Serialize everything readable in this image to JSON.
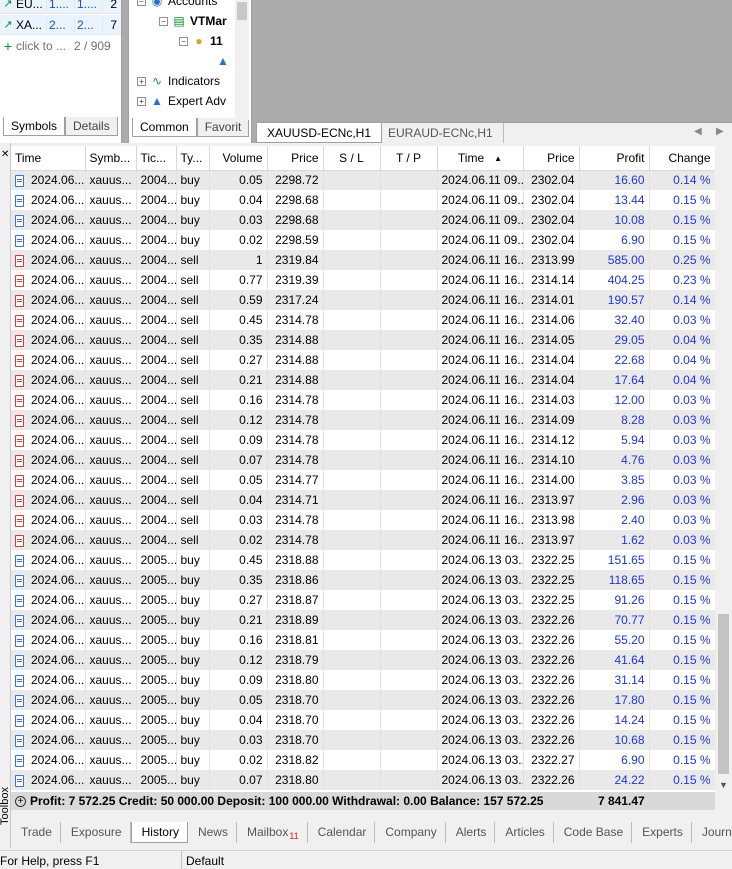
{
  "market_watch": {
    "rows": [
      {
        "symbol": "EU...",
        "bid": "1....",
        "ask": "1....",
        "spread": "2"
      },
      {
        "symbol": "XA...",
        "bid": "2...",
        "ask": "2...",
        "spread": "7"
      }
    ],
    "add_label": "click to ...",
    "count": "2 / 909",
    "tabs": [
      "Symbols",
      "Details"
    ]
  },
  "navigator": {
    "accounts": "Accounts",
    "server": "VTMar",
    "account": "11",
    "indicators": "Indicators",
    "expert_advisors": "Expert Adv",
    "tabs": [
      "Common",
      "Favorit"
    ]
  },
  "chart_tabs": [
    "XAUUSD-ECNc,H1",
    "EURAUD-ECNc,H1"
  ],
  "columns": [
    "Time",
    "Symb...",
    "Tic...",
    "Ty...",
    "Volume",
    "Price",
    "S / L",
    "T / P",
    "Time",
    "Price",
    "Profit",
    "Change"
  ],
  "rows": [
    {
      "time": "2024.06...",
      "symbol": "xauus...",
      "ticket": "2004...",
      "type": "buy",
      "volume": "0.05",
      "price": "2298.72",
      "sl": "",
      "tp": "",
      "close_time": "2024.06.11 09...",
      "close_price": "2302.04",
      "profit": "16.60",
      "change": "0.14 %"
    },
    {
      "time": "2024.06...",
      "symbol": "xauus...",
      "ticket": "2004...",
      "type": "buy",
      "volume": "0.04",
      "price": "2298.68",
      "sl": "",
      "tp": "",
      "close_time": "2024.06.11 09...",
      "close_price": "2302.04",
      "profit": "13.44",
      "change": "0.15 %"
    },
    {
      "time": "2024.06...",
      "symbol": "xauus...",
      "ticket": "2004...",
      "type": "buy",
      "volume": "0.03",
      "price": "2298.68",
      "sl": "",
      "tp": "",
      "close_time": "2024.06.11 09...",
      "close_price": "2302.04",
      "profit": "10.08",
      "change": "0.15 %"
    },
    {
      "time": "2024.06...",
      "symbol": "xauus...",
      "ticket": "2004...",
      "type": "buy",
      "volume": "0.02",
      "price": "2298.59",
      "sl": "",
      "tp": "",
      "close_time": "2024.06.11 09...",
      "close_price": "2302.04",
      "profit": "6.90",
      "change": "0.15 %"
    },
    {
      "time": "2024.06...",
      "symbol": "xauus...",
      "ticket": "2004...",
      "type": "sell",
      "volume": "1",
      "price": "2319.84",
      "sl": "",
      "tp": "",
      "close_time": "2024.06.11 16...",
      "close_price": "2313.99",
      "profit": "585.00",
      "change": "0.25 %"
    },
    {
      "time": "2024.06...",
      "symbol": "xauus...",
      "ticket": "2004...",
      "type": "sell",
      "volume": "0.77",
      "price": "2319.39",
      "sl": "",
      "tp": "",
      "close_time": "2024.06.11 16...",
      "close_price": "2314.14",
      "profit": "404.25",
      "change": "0.23 %"
    },
    {
      "time": "2024.06...",
      "symbol": "xauus...",
      "ticket": "2004...",
      "type": "sell",
      "volume": "0.59",
      "price": "2317.24",
      "sl": "",
      "tp": "",
      "close_time": "2024.06.11 16...",
      "close_price": "2314.01",
      "profit": "190.57",
      "change": "0.14 %"
    },
    {
      "time": "2024.06...",
      "symbol": "xauus...",
      "ticket": "2004...",
      "type": "sell",
      "volume": "0.45",
      "price": "2314.78",
      "sl": "",
      "tp": "",
      "close_time": "2024.06.11 16...",
      "close_price": "2314.06",
      "profit": "32.40",
      "change": "0.03 %"
    },
    {
      "time": "2024.06...",
      "symbol": "xauus...",
      "ticket": "2004...",
      "type": "sell",
      "volume": "0.35",
      "price": "2314.88",
      "sl": "",
      "tp": "",
      "close_time": "2024.06.11 16...",
      "close_price": "2314.05",
      "profit": "29.05",
      "change": "0.04 %"
    },
    {
      "time": "2024.06...",
      "symbol": "xauus...",
      "ticket": "2004...",
      "type": "sell",
      "volume": "0.27",
      "price": "2314.88",
      "sl": "",
      "tp": "",
      "close_time": "2024.06.11 16...",
      "close_price": "2314.04",
      "profit": "22.68",
      "change": "0.04 %"
    },
    {
      "time": "2024.06...",
      "symbol": "xauus...",
      "ticket": "2004...",
      "type": "sell",
      "volume": "0.21",
      "price": "2314.88",
      "sl": "",
      "tp": "",
      "close_time": "2024.06.11 16...",
      "close_price": "2314.04",
      "profit": "17.64",
      "change": "0.04 %"
    },
    {
      "time": "2024.06...",
      "symbol": "xauus...",
      "ticket": "2004...",
      "type": "sell",
      "volume": "0.16",
      "price": "2314.78",
      "sl": "",
      "tp": "",
      "close_time": "2024.06.11 16...",
      "close_price": "2314.03",
      "profit": "12.00",
      "change": "0.03 %"
    },
    {
      "time": "2024.06...",
      "symbol": "xauus...",
      "ticket": "2004...",
      "type": "sell",
      "volume": "0.12",
      "price": "2314.78",
      "sl": "",
      "tp": "",
      "close_time": "2024.06.11 16...",
      "close_price": "2314.09",
      "profit": "8.28",
      "change": "0.03 %"
    },
    {
      "time": "2024.06...",
      "symbol": "xauus...",
      "ticket": "2004...",
      "type": "sell",
      "volume": "0.09",
      "price": "2314.78",
      "sl": "",
      "tp": "",
      "close_time": "2024.06.11 16...",
      "close_price": "2314.12",
      "profit": "5.94",
      "change": "0.03 %"
    },
    {
      "time": "2024.06...",
      "symbol": "xauus...",
      "ticket": "2004...",
      "type": "sell",
      "volume": "0.07",
      "price": "2314.78",
      "sl": "",
      "tp": "",
      "close_time": "2024.06.11 16...",
      "close_price": "2314.10",
      "profit": "4.76",
      "change": "0.03 %"
    },
    {
      "time": "2024.06...",
      "symbol": "xauus...",
      "ticket": "2004...",
      "type": "sell",
      "volume": "0.05",
      "price": "2314.77",
      "sl": "",
      "tp": "",
      "close_time": "2024.06.11 16...",
      "close_price": "2314.00",
      "profit": "3.85",
      "change": "0.03 %"
    },
    {
      "time": "2024.06...",
      "symbol": "xauus...",
      "ticket": "2004...",
      "type": "sell",
      "volume": "0.04",
      "price": "2314.71",
      "sl": "",
      "tp": "",
      "close_time": "2024.06.11 16...",
      "close_price": "2313.97",
      "profit": "2.96",
      "change": "0.03 %"
    },
    {
      "time": "2024.06...",
      "symbol": "xauus...",
      "ticket": "2004...",
      "type": "sell",
      "volume": "0.03",
      "price": "2314.78",
      "sl": "",
      "tp": "",
      "close_time": "2024.06.11 16...",
      "close_price": "2313.98",
      "profit": "2.40",
      "change": "0.03 %"
    },
    {
      "time": "2024.06...",
      "symbol": "xauus...",
      "ticket": "2004...",
      "type": "sell",
      "volume": "0.02",
      "price": "2314.78",
      "sl": "",
      "tp": "",
      "close_time": "2024.06.11 16...",
      "close_price": "2313.97",
      "profit": "1.62",
      "change": "0.03 %"
    },
    {
      "time": "2024.06...",
      "symbol": "xauus...",
      "ticket": "2005...",
      "type": "buy",
      "volume": "0.45",
      "price": "2318.88",
      "sl": "",
      "tp": "",
      "close_time": "2024.06.13 03...",
      "close_price": "2322.25",
      "profit": "151.65",
      "change": "0.15 %"
    },
    {
      "time": "2024.06...",
      "symbol": "xauus...",
      "ticket": "2005...",
      "type": "buy",
      "volume": "0.35",
      "price": "2318.86",
      "sl": "",
      "tp": "",
      "close_time": "2024.06.13 03...",
      "close_price": "2322.25",
      "profit": "118.65",
      "change": "0.15 %"
    },
    {
      "time": "2024.06...",
      "symbol": "xauus...",
      "ticket": "2005...",
      "type": "buy",
      "volume": "0.27",
      "price": "2318.87",
      "sl": "",
      "tp": "",
      "close_time": "2024.06.13 03...",
      "close_price": "2322.25",
      "profit": "91.26",
      "change": "0.15 %"
    },
    {
      "time": "2024.06...",
      "symbol": "xauus...",
      "ticket": "2005...",
      "type": "buy",
      "volume": "0.21",
      "price": "2318.89",
      "sl": "",
      "tp": "",
      "close_time": "2024.06.13 03...",
      "close_price": "2322.26",
      "profit": "70.77",
      "change": "0.15 %"
    },
    {
      "time": "2024.06...",
      "symbol": "xauus...",
      "ticket": "2005...",
      "type": "buy",
      "volume": "0.16",
      "price": "2318.81",
      "sl": "",
      "tp": "",
      "close_time": "2024.06.13 03...",
      "close_price": "2322.26",
      "profit": "55.20",
      "change": "0.15 %"
    },
    {
      "time": "2024.06...",
      "symbol": "xauus...",
      "ticket": "2005...",
      "type": "buy",
      "volume": "0.12",
      "price": "2318.79",
      "sl": "",
      "tp": "",
      "close_time": "2024.06.13 03...",
      "close_price": "2322.26",
      "profit": "41.64",
      "change": "0.15 %"
    },
    {
      "time": "2024.06...",
      "symbol": "xauus...",
      "ticket": "2005...",
      "type": "buy",
      "volume": "0.09",
      "price": "2318.80",
      "sl": "",
      "tp": "",
      "close_time": "2024.06.13 03...",
      "close_price": "2322.26",
      "profit": "31.14",
      "change": "0.15 %"
    },
    {
      "time": "2024.06...",
      "symbol": "xauus...",
      "ticket": "2005...",
      "type": "buy",
      "volume": "0.05",
      "price": "2318.70",
      "sl": "",
      "tp": "",
      "close_time": "2024.06.13 03...",
      "close_price": "2322.26",
      "profit": "17.80",
      "change": "0.15 %"
    },
    {
      "time": "2024.06...",
      "symbol": "xauus...",
      "ticket": "2005...",
      "type": "buy",
      "volume": "0.04",
      "price": "2318.70",
      "sl": "",
      "tp": "",
      "close_time": "2024.06.13 03...",
      "close_price": "2322.26",
      "profit": "14.24",
      "change": "0.15 %"
    },
    {
      "time": "2024.06...",
      "symbol": "xauus...",
      "ticket": "2005...",
      "type": "buy",
      "volume": "0.03",
      "price": "2318.70",
      "sl": "",
      "tp": "",
      "close_time": "2024.06.13 03...",
      "close_price": "2322.26",
      "profit": "10.68",
      "change": "0.15 %"
    },
    {
      "time": "2024.06...",
      "symbol": "xauus...",
      "ticket": "2005...",
      "type": "buy",
      "volume": "0.02",
      "price": "2318.82",
      "sl": "",
      "tp": "",
      "close_time": "2024.06.13 03...",
      "close_price": "2322.27",
      "profit": "6.90",
      "change": "0.15 %"
    },
    {
      "time": "2024.06...",
      "symbol": "xauus...",
      "ticket": "2005...",
      "type": "buy",
      "volume": "0.07",
      "price": "2318.80",
      "sl": "",
      "tp": "",
      "close_time": "2024.06.13 03...",
      "close_price": "2322.26",
      "profit": "24.22",
      "change": "0.15 %"
    }
  ],
  "summary": {
    "text": "Profit: 7 572.25  Credit: 50 000.00  Deposit: 100 000.00  Withdrawal: 0.00  Balance: 157 572.25",
    "total": "7 841.47"
  },
  "toolbox_label": "Toolbox",
  "bottom_tabs": [
    {
      "label": "Trade"
    },
    {
      "label": "Exposure"
    },
    {
      "label": "History"
    },
    {
      "label": "News"
    },
    {
      "label": "Mailbox",
      "badge": "11"
    },
    {
      "label": "Calendar"
    },
    {
      "label": "Company"
    },
    {
      "label": "Alerts"
    },
    {
      "label": "Articles"
    },
    {
      "label": "Code Base"
    },
    {
      "label": "Experts"
    },
    {
      "label": "Journ"
    }
  ],
  "status": {
    "help": "For Help, press F1",
    "profile": "Default"
  },
  "colors": {
    "profit": "#1f35d8",
    "buy_icon": "#3a6fd0",
    "sell_icon": "#d03a3a",
    "row_alt": "#e9e9e9",
    "summary_bg": "#d9d9d9"
  }
}
